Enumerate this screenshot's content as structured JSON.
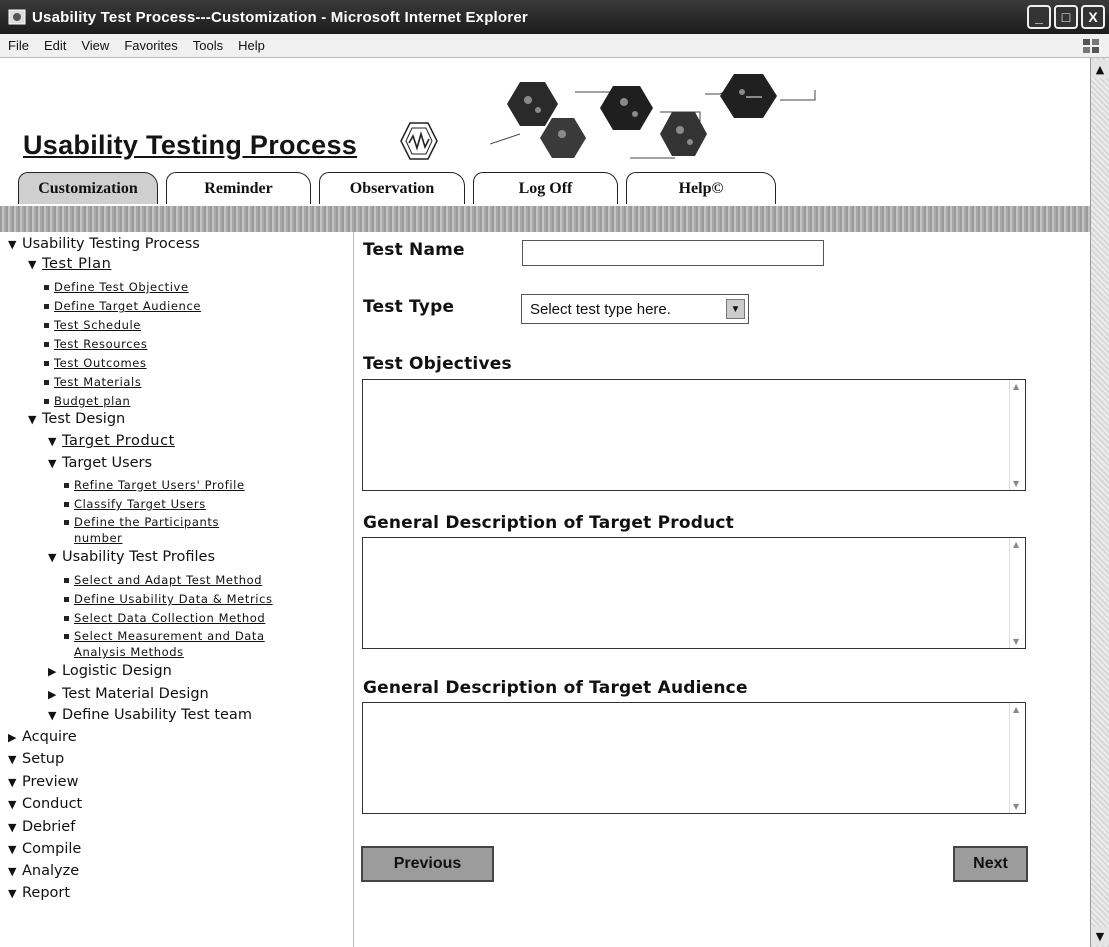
{
  "window": {
    "title": "Usability Test Process---Customization - Microsoft Internet Explorer",
    "buttons": [
      "_",
      "□",
      "X"
    ]
  },
  "menubar": {
    "items": [
      "File",
      "Edit",
      "View",
      "Favorites",
      "Tools",
      "Help"
    ]
  },
  "header": {
    "title": "Usability Testing Process",
    "tabs": [
      {
        "label": "Customization",
        "active": true
      },
      {
        "label": "Reminder",
        "active": false
      },
      {
        "label": "Observation",
        "active": false
      },
      {
        "label": "Log Off",
        "active": false
      },
      {
        "label": "Help©",
        "active": false
      }
    ]
  },
  "nav": {
    "items": [
      {
        "label": "Usability Testing Process",
        "marker": "open",
        "link": false
      },
      {
        "label": "Test Plan",
        "marker": "open",
        "link": true
      },
      {
        "label": "Define Test Objective",
        "marker": "bullet",
        "link": true
      },
      {
        "label": "Define Target Audience",
        "marker": "bullet",
        "link": true
      },
      {
        "label": "Test Schedule",
        "marker": "bullet",
        "link": true
      },
      {
        "label": "Test Resources",
        "marker": "bullet",
        "link": true
      },
      {
        "label": "Test Outcomes",
        "marker": "bullet",
        "link": true
      },
      {
        "label": "Test Materials",
        "marker": "bullet",
        "link": true
      },
      {
        "label": "Budget plan",
        "marker": "bullet",
        "link": true
      },
      {
        "label": "Test Design",
        "marker": "open",
        "link": false
      },
      {
        "label": "Target Product",
        "marker": "open",
        "link": true
      },
      {
        "label": "Target Users",
        "marker": "open",
        "link": false
      },
      {
        "label": "Refine Target Users' Profile",
        "marker": "bullet",
        "link": true
      },
      {
        "label": "Classify Target Users",
        "marker": "bullet",
        "link": true
      },
      {
        "label": "Define the Participants",
        "marker": "bullet",
        "link": true
      },
      {
        "label": "number",
        "marker": "none",
        "link": true
      },
      {
        "label": "Usability Test Profiles",
        "marker": "open",
        "link": false
      },
      {
        "label": "Select and Adapt Test Method",
        "marker": "bullet",
        "link": true
      },
      {
        "label": "Define Usability Data & Metrics",
        "marker": "bullet",
        "link": true
      },
      {
        "label": "Select Data Collection Method",
        "marker": "bullet",
        "link": true
      },
      {
        "label": "Select Measurement and Data",
        "marker": "bullet",
        "link": true
      },
      {
        "label": "Analysis Methods",
        "marker": "none",
        "link": true
      },
      {
        "label": "Logistic Design",
        "marker": "closed",
        "link": false
      },
      {
        "label": "Test Material Design",
        "marker": "closed",
        "link": false
      },
      {
        "label": "Define Usability Test team",
        "marker": "open",
        "link": false
      },
      {
        "label": "Acquire",
        "marker": "closed",
        "link": false
      },
      {
        "label": "Setup",
        "marker": "open",
        "link": false
      },
      {
        "label": "Preview",
        "marker": "open",
        "link": false
      },
      {
        "label": "Conduct",
        "marker": "open",
        "link": false
      },
      {
        "label": "Debrief",
        "marker": "open",
        "link": false
      },
      {
        "label": "Compile",
        "marker": "open",
        "link": false
      },
      {
        "label": "Analyze",
        "marker": "open",
        "link": false
      },
      {
        "label": "Report",
        "marker": "open",
        "link": false
      }
    ]
  },
  "form": {
    "test_name_label": "Test Name",
    "test_name_value": "",
    "test_type_label": "Test Type",
    "test_type_selected": "Select test type here.",
    "objectives_label": "Test Objectives",
    "product_label": "General Description of Target Product",
    "audience_label": "General Description of Target Audience",
    "previous_label": "Previous",
    "next_label": "Next"
  }
}
